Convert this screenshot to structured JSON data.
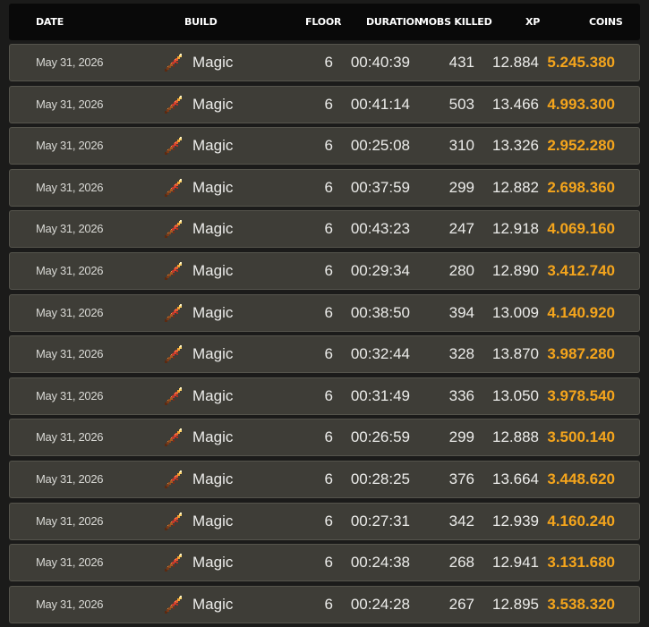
{
  "header": {
    "date": "DATE",
    "build": "BUILD",
    "floor": "FLOOR",
    "duration": "DURATION",
    "mobs_killed": "MOBS KILLED",
    "xp": "XP",
    "coins": "COINS"
  },
  "build_icon": "magic-wand-icon",
  "colors": {
    "coins": "#f5a51c",
    "row_bg": "#3e3d37",
    "header_bg": "#090909"
  },
  "rows": [
    {
      "date": "May 31, 2026",
      "build": "Magic",
      "floor": "6",
      "duration": "00:40:39",
      "mobs": "431",
      "xp": "12.884",
      "coins": "5.245.380"
    },
    {
      "date": "May 31, 2026",
      "build": "Magic",
      "floor": "6",
      "duration": "00:41:14",
      "mobs": "503",
      "xp": "13.466",
      "coins": "4.993.300"
    },
    {
      "date": "May 31, 2026",
      "build": "Magic",
      "floor": "6",
      "duration": "00:25:08",
      "mobs": "310",
      "xp": "13.326",
      "coins": "2.952.280"
    },
    {
      "date": "May 31, 2026",
      "build": "Magic",
      "floor": "6",
      "duration": "00:37:59",
      "mobs": "299",
      "xp": "12.882",
      "coins": "2.698.360"
    },
    {
      "date": "May 31, 2026",
      "build": "Magic",
      "floor": "6",
      "duration": "00:43:23",
      "mobs": "247",
      "xp": "12.918",
      "coins": "4.069.160"
    },
    {
      "date": "May 31, 2026",
      "build": "Magic",
      "floor": "6",
      "duration": "00:29:34",
      "mobs": "280",
      "xp": "12.890",
      "coins": "3.412.740"
    },
    {
      "date": "May 31, 2026",
      "build": "Magic",
      "floor": "6",
      "duration": "00:38:50",
      "mobs": "394",
      "xp": "13.009",
      "coins": "4.140.920"
    },
    {
      "date": "May 31, 2026",
      "build": "Magic",
      "floor": "6",
      "duration": "00:32:44",
      "mobs": "328",
      "xp": "13.870",
      "coins": "3.987.280"
    },
    {
      "date": "May 31, 2026",
      "build": "Magic",
      "floor": "6",
      "duration": "00:31:49",
      "mobs": "336",
      "xp": "13.050",
      "coins": "3.978.540"
    },
    {
      "date": "May 31, 2026",
      "build": "Magic",
      "floor": "6",
      "duration": "00:26:59",
      "mobs": "299",
      "xp": "12.888",
      "coins": "3.500.140"
    },
    {
      "date": "May 31, 2026",
      "build": "Magic",
      "floor": "6",
      "duration": "00:28:25",
      "mobs": "376",
      "xp": "13.664",
      "coins": "3.448.620"
    },
    {
      "date": "May 31, 2026",
      "build": "Magic",
      "floor": "6",
      "duration": "00:27:31",
      "mobs": "342",
      "xp": "12.939",
      "coins": "4.160.240"
    },
    {
      "date": "May 31, 2026",
      "build": "Magic",
      "floor": "6",
      "duration": "00:24:38",
      "mobs": "268",
      "xp": "12.941",
      "coins": "3.131.680"
    },
    {
      "date": "May 31, 2026",
      "build": "Magic",
      "floor": "6",
      "duration": "00:24:28",
      "mobs": "267",
      "xp": "12.895",
      "coins": "3.538.320"
    }
  ]
}
